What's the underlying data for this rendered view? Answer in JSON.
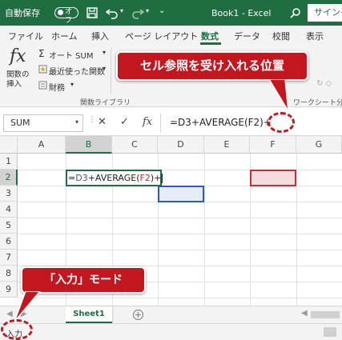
{
  "titlebar": {
    "autosave_label": "自動保存",
    "toggle_state": "オフ",
    "doc_title": "Book1 - Excel",
    "signin_label": "サインイン",
    "icons": [
      "save-icon",
      "undo-icon",
      "redo-icon",
      "search-icon"
    ]
  },
  "tabs": [
    "ファイル",
    "ホーム",
    "挿入",
    "ページ レイアウト",
    "数式",
    "データ",
    "校閲",
    "表示"
  ],
  "active_tab": "数式",
  "ribbon": {
    "insert_function_glyph": "fx",
    "insert_function_label": "関数の挿入",
    "autosum_label": "オート SUM",
    "recent_label": "最近使った関数",
    "financial_label": "財務",
    "group_function_library": "関数ライブラリ",
    "group_watch_window": "ワークシート分析"
  },
  "formula_bar": {
    "name_box": "SUM",
    "cancel_glyph": "✕",
    "enter_glyph": "✓",
    "fx_glyph": "fx",
    "formula_text": "=D3+AVERAGE(F2)+"
  },
  "grid": {
    "columns": [
      "A",
      "B",
      "C",
      "D",
      "E",
      "F",
      "G"
    ],
    "selected_column": "B",
    "rows": [
      "1",
      "2",
      "3",
      "4",
      "5",
      "6",
      "7",
      "8",
      "9"
    ],
    "selected_row": "2",
    "active_cell": "B2",
    "cell_formula_parts": {
      "eq": "=",
      "ref1": "D3",
      "mid": "+AVERAGE(",
      "ref2": "F2",
      "end": ")+"
    },
    "ref_colors": {
      "D3": "#2e58c8",
      "F2": "#c0313a"
    }
  },
  "sheets": [
    "Sheet1"
  ],
  "status": {
    "mode": "入力"
  },
  "callouts": {
    "top": "セル参照を受け入れる位置",
    "bottom": "「入力」モード"
  },
  "colors": {
    "excel_green": "#1e6e42",
    "callout_red": "#c2171f"
  }
}
